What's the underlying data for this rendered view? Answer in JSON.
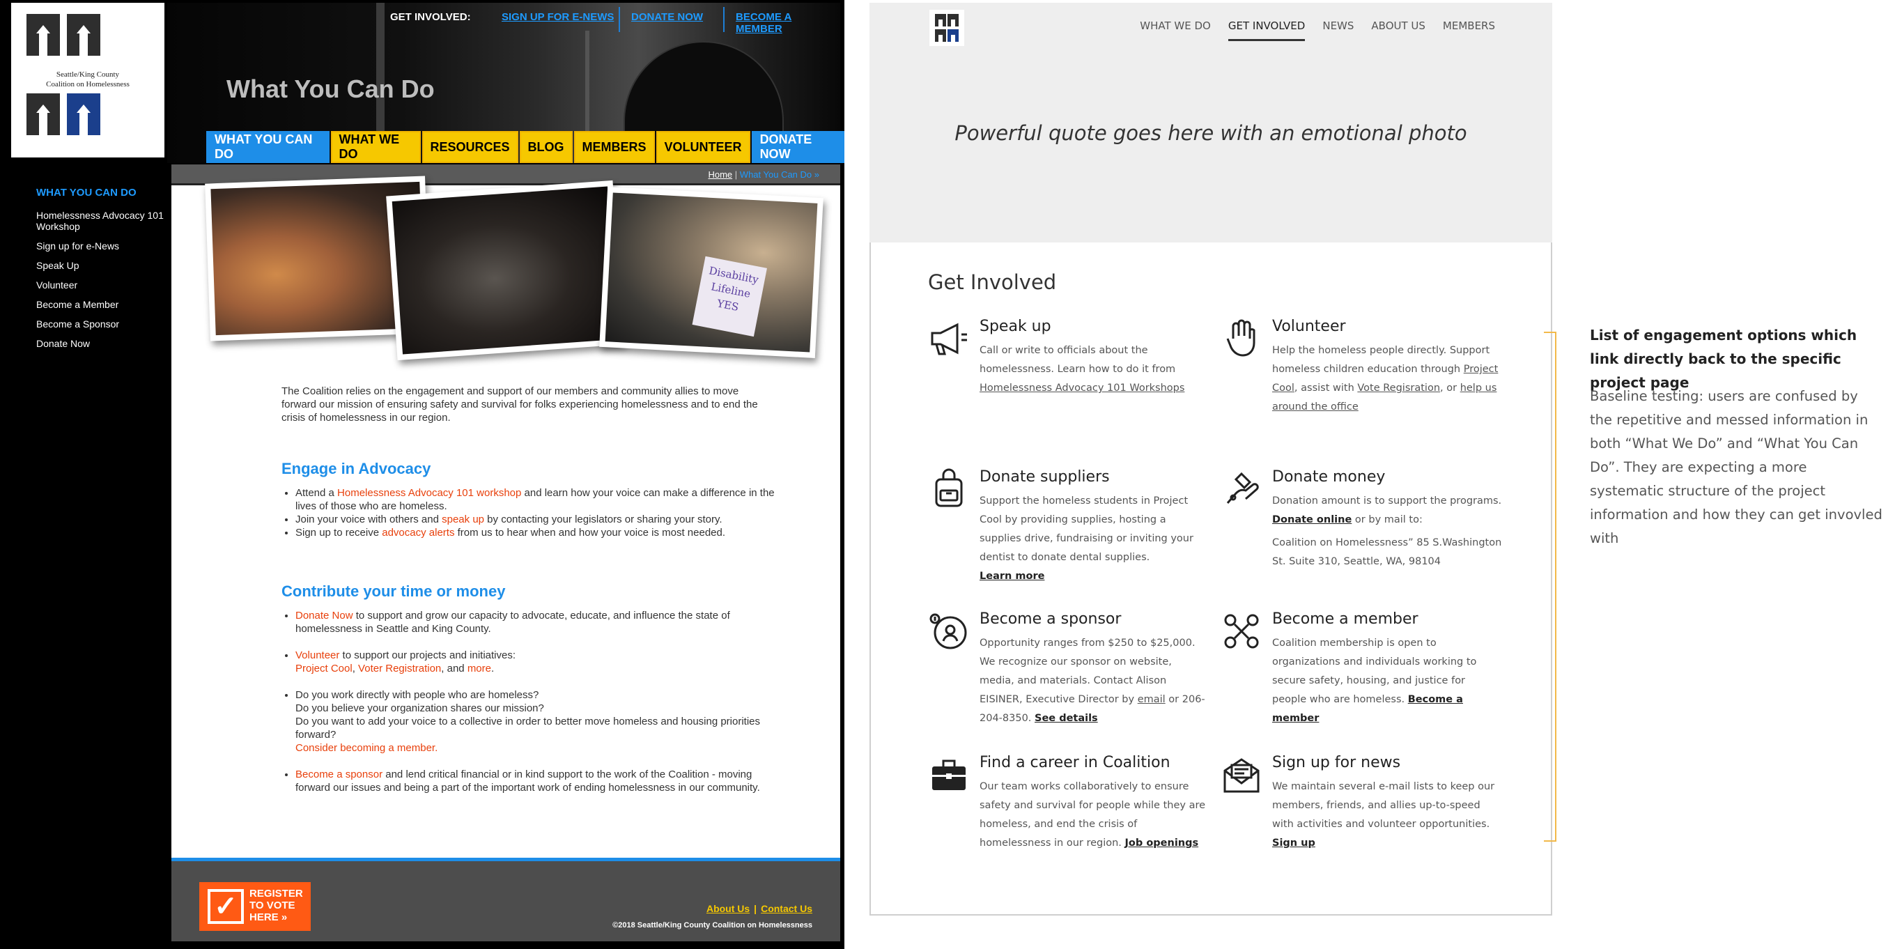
{
  "old_site": {
    "logo": {
      "line1": "Seattle/King County",
      "line2": "Coalition on Homelessness"
    },
    "header": {
      "page_title": "What You Can Do",
      "get_involved_label": "GET INVOLVED:",
      "links": [
        "SIGN UP FOR E-NEWS",
        "DONATE NOW",
        "BECOME A MEMBER"
      ]
    },
    "nav": [
      "WHAT YOU CAN DO",
      "WHAT WE DO",
      "RESOURCES",
      "BLOG",
      "MEMBERS",
      "VOLUNTEER",
      "DONATE NOW"
    ],
    "sidebar": {
      "heading": "WHAT YOU CAN DO",
      "items": [
        "Homelessness Advocacy 101 Workshop",
        "Sign up for e-News",
        "Speak Up",
        "Volunteer",
        "Become a Member",
        "Become a Sponsor",
        "Donate Now"
      ]
    },
    "breadcrumb": {
      "home": "Home",
      "sep": "|",
      "current": "What You Can Do »"
    },
    "photo_sign": [
      "Disability",
      "Lifeline",
      "YES"
    ],
    "intro": "The Coalition relies on the engagement and support of our members and community allies to move forward our mission of ensuring safety and survival for folks experiencing homelessness and to end the crisis of homelessness in our region.",
    "engage": {
      "heading": "Engage in Advocacy",
      "b1_pre": "Attend a ",
      "b1_link": "Homelessness Advocacy 101 workshop",
      "b1_post": " and learn how your voice can make a difference in the lives of those who are homeless.",
      "b2_pre": "Join your voice with others and ",
      "b2_link": "speak up",
      "b2_post": " by contacting your legislators or sharing your story.",
      "b3_pre": "Sign up to receive ",
      "b3_link": "advocacy alerts",
      "b3_post": " from us to hear when and how your voice is most needed."
    },
    "contribute": {
      "heading": "Contribute your time or money",
      "b1_link": "Donate Now",
      "b1_post": " to support and grow our capacity to advocate, educate, and influence the state of homelessness in Seattle and King County.",
      "b2_link": "Volunteer",
      "b2_post": " to support our projects and initiatives:",
      "b2_l2": "Project Cool",
      "b2_l3": "Voter Registration",
      "b2_l4": "more",
      "b3_q1": "Do you work directly with people who are homeless?",
      "b3_q2": "Do you believe your organization shares our mission?",
      "b3_q3": "Do you want to add your voice to a collective in order to better move homeless and housing priorities forward?",
      "b3_link": "Consider becoming a member.",
      "b4_link": "Become a sponsor",
      "b4_post": " and lend critical financial or in kind support to the work of the Coalition - moving forward our issues and being a part of the important work of ending homelessness in our community."
    },
    "footer": {
      "register": [
        "REGISTER",
        "TO VOTE",
        "HERE »"
      ],
      "check": "✓",
      "about": "About Us",
      "pipe": "|",
      "contact": "Contact Us",
      "copyright": "©2018 Seattle/King County Coalition on Homelessness"
    }
  },
  "new_design": {
    "nav": [
      "WHAT WE DO",
      "GET INVOLVED",
      "NEWS",
      "ABOUT US",
      "MEMBERS"
    ],
    "active_nav": "GET INVOLVED",
    "quote": "Powerful quote goes here with an emotional photo",
    "section_title": "Get Involved",
    "cards": {
      "speak": {
        "icon": "megaphone-icon",
        "title": "Speak up",
        "text": "Call or write to officials about the homelessness. Learn how to do it from ",
        "link": "Homelessness Advocacy 101 Workshops"
      },
      "volunteer": {
        "icon": "raised-hand-icon",
        "title": "Volunteer",
        "t1": "Help the homeless people directly. Support homeless children education through ",
        "l1": "Project Cool",
        "t2": ", assist with ",
        "l2": "Vote Regisration",
        "t3": ", or ",
        "l3": "help us around the office"
      },
      "suppliers": {
        "icon": "backpack-icon",
        "title": "Donate suppliers",
        "text": "Support the homeless students in Project Cool by providing supplies, hosting a supplies drive, fundraising or inviting your dentist to donate dental supplies.",
        "link": "Learn more"
      },
      "money": {
        "icon": "donate-hand-icon",
        "title": "Donate money",
        "t1": "Donation amount is to support the programs.",
        "link": "Donate online",
        "t2": " or by mail to:",
        "address": "Coalition on Homelessness” 85 S.Washington St. Suite 310, Seattle, WA, 98104"
      },
      "sponsor": {
        "icon": "sponsor-icon",
        "title": "Become a sponsor",
        "t1": "Opportunity ranges from $250 to $25,000. We recognize our sponsor on website, media, and materials. Contact Alison EISINER, Executive Director by ",
        "l1": "email",
        "t2": " or 206-204-8350. ",
        "l2": "See details"
      },
      "member": {
        "icon": "network-people-icon",
        "title": "Become a member",
        "text": "Coalition membership is open to organizations and individuals working to secure safety, housing, and justice for people who are homeless. ",
        "link": "Become a member"
      },
      "career": {
        "icon": "briefcase-icon",
        "title": "Find a career in Coalition",
        "text": "Our team works collaboratively to ensure safety and survival for people while they are homeless, and end the crisis of homelessness in our region. ",
        "link": "Job openings"
      },
      "news": {
        "icon": "envelope-icon",
        "title": "Sign up for news",
        "text": "We maintain several e-mail lists to keep our members, friends, and allies up-to-speed with activities and volunteer opportunities.",
        "link": "Sign up"
      }
    }
  },
  "annotation": {
    "title": "List of engagement options which link directly back to the specific project page",
    "text": "Baseline testing: users are confused by the repetitive and messed information in both “What We Do” and “What You Can Do”. They are expecting a more systematic structure of the project information and how they can get invovled with"
  },
  "colors": {
    "old_blue": "#1e8ee8",
    "old_yellow": "#f6c800",
    "old_red": "#e8400c",
    "bracket": "#f2b94a"
  }
}
